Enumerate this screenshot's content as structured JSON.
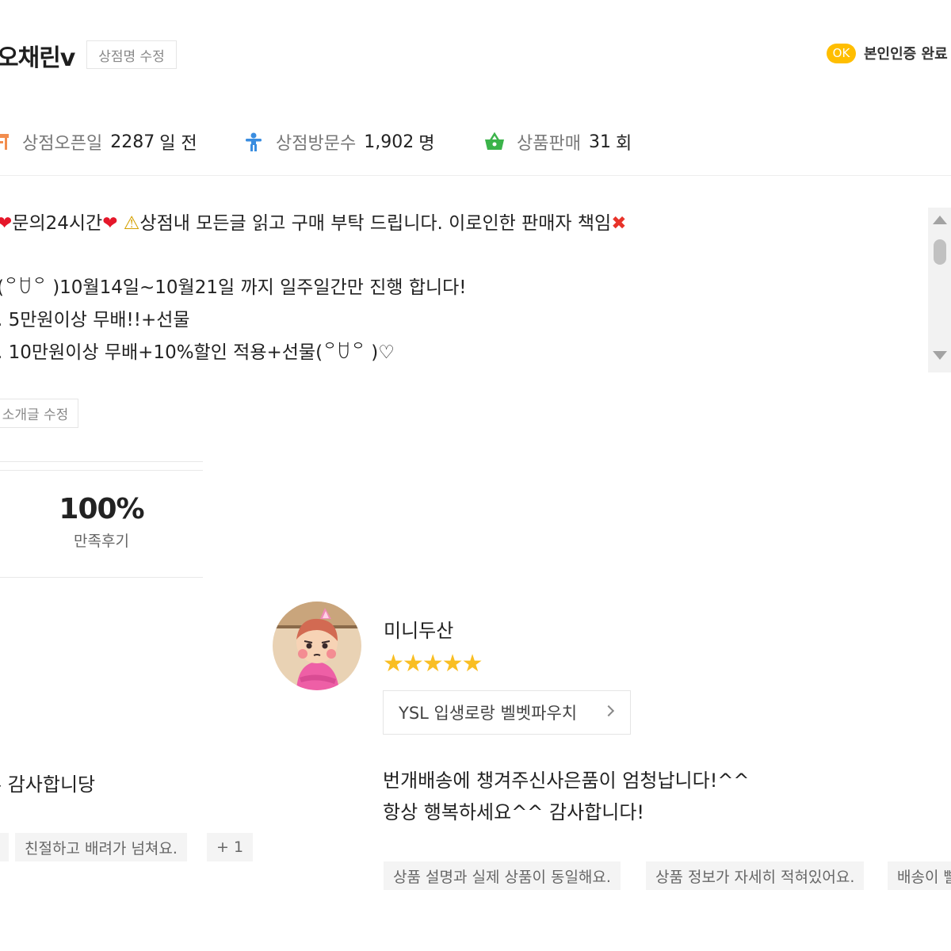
{
  "shop": {
    "name": "오채린v",
    "edit_name_label": "상점명 수정",
    "verify_badge": "OK",
    "verify_label": "본인인증 완료"
  },
  "stats": {
    "open": {
      "label": "상점오픈일",
      "value": "2287",
      "unit": "일 전",
      "icon": "store-icon",
      "color": "#f28d4e"
    },
    "visits": {
      "label": "상점방문수",
      "value": "1,902",
      "unit": "명",
      "icon": "person-icon",
      "color": "#3a8de0"
    },
    "sales": {
      "label": "상품판매",
      "value": "31",
      "unit": "회",
      "icon": "basket-icon",
      "color": "#3bb34a"
    }
  },
  "intro": {
    "line1_a": "문의24시간",
    "line1_b": "상점내 모든글 읽고 구매 부탁 드립니다. 이로인한 판매자 책임",
    "line2": "(꒪ꇴ꒪ )10월14일~10월21일 까지 일주일간만 진행 합니다!",
    "line3": ".  5만원이상 무배!!+선물",
    "line4": ". 10만원이상 무배+10%할인 적용+선물(꒪ꇴ꒪ )♡",
    "heart_glyph": "❤",
    "warn_glyph": "⚠",
    "x_glyph": "✖",
    "edit_label": "소개글 수정"
  },
  "satisfaction": {
    "value": "100%",
    "label": "만족후기"
  },
  "left_review": {
    "text": "무 감사합니당",
    "tags": [
      "",
      "친절하고 배려가 넘쳐요.",
      "+ 1"
    ]
  },
  "review": {
    "reviewer": "미니두산",
    "stars": "★★★★★",
    "rating": 5,
    "product": "YSL 입생로랑 벨벳파우치",
    "text_line1": "번개배송에 챙겨주신사은품이 엄청납니다!^^",
    "text_line2": "항상 행복하세요^^ 감사합니다!",
    "tags": [
      "상품 설명과 실제 상품이 동일해요.",
      "상품 정보가 자세히 적혀있어요.",
      "배송이 빨라요."
    ]
  }
}
